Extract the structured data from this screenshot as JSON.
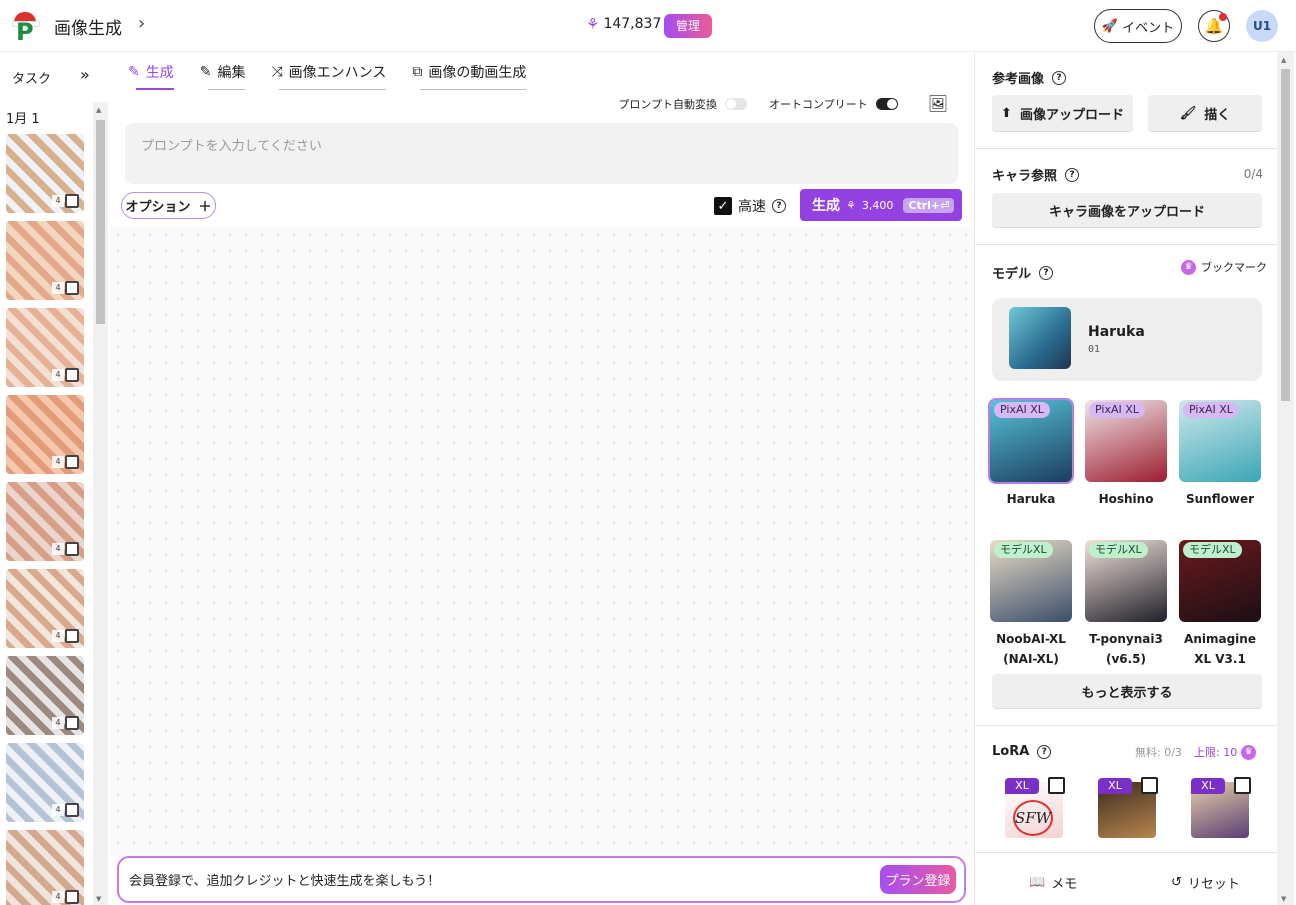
{
  "header": {
    "app_title": "画像生成",
    "credits": "147,837",
    "admin_badge": "管理",
    "event_label": "イベント",
    "avatar_initials": "U1"
  },
  "left": {
    "task_label": "タスク",
    "date_label": "1月 1",
    "thumb_count": "4",
    "thumbs": [
      {
        "c1": "#d9b08c",
        "c2": "#eef2f7"
      },
      {
        "c1": "#e3a88a",
        "c2": "#f3d6c0"
      },
      {
        "c1": "#e8b195",
        "c2": "#f2e0d4"
      },
      {
        "c1": "#e39c79",
        "c2": "#f5c8ae"
      },
      {
        "c1": "#d99e87",
        "c2": "#ead6cc"
      },
      {
        "c1": "#d9a88d",
        "c2": "#f1e6dc"
      },
      {
        "c1": "#9c8a82",
        "c2": "#e9e4e4"
      },
      {
        "c1": "#b6c3d5",
        "c2": "#eef1f6"
      },
      {
        "c1": "#d5a98e",
        "c2": "#efe5de"
      }
    ]
  },
  "tabs": [
    {
      "label": "生成",
      "icon": "✎"
    },
    {
      "label": "編集",
      "icon": "✎"
    },
    {
      "label": "画像エンハンス",
      "icon": "⤨"
    },
    {
      "label": "画像の動画生成",
      "icon": "⧉"
    }
  ],
  "toggles": {
    "auto_convert": "プロンプト自動変換",
    "autocomplete": "オートコンプリート"
  },
  "prompt": {
    "placeholder": "プロンプトを入力してください",
    "value": ""
  },
  "controls": {
    "options_label": "オプション",
    "fast_label": "高速",
    "generate_label": "生成",
    "generate_cost": "3,400",
    "shortcut": "Ctrl+⏎"
  },
  "promo": {
    "text": "会員登録で、追加クレジットと快速生成を楽しもう！",
    "button": "プラン登録"
  },
  "right": {
    "ref_title": "参考画像",
    "upload_btn": "画像アップロード",
    "draw_btn": "描く",
    "char_title": "キャラ参照",
    "char_count": "0/4",
    "char_upload_btn": "キャラ画像をアップロード",
    "model_title": "モデル",
    "bookmark_label": "ブックマーク",
    "selected_model": {
      "name": "Haruka",
      "version": "01"
    },
    "models": [
      {
        "tag": "PixAI XL",
        "name": "Haruka",
        "c1": "#57c3d9",
        "c2": "#1b3c5e"
      },
      {
        "tag": "PixAI XL",
        "name": "Hoshino",
        "c1": "#f0e6ea",
        "c2": "#9c1d2f"
      },
      {
        "tag": "PixAI XL",
        "name": "Sunflower",
        "c1": "#cfe8ec",
        "c2": "#3aa6b5"
      },
      {
        "tag": "モデルXL",
        "name": "NoobAI-XL (NAI-XL)",
        "c1": "#e9ddc4",
        "c2": "#3b4d6b"
      },
      {
        "tag": "モデルXL",
        "name": "T-ponynai3 (v6.5)",
        "c1": "#f3e2dc",
        "c2": "#1f1f28"
      },
      {
        "tag": "モデルXL",
        "name": "Animagine XL V3.1",
        "c1": "#6b1a1e",
        "c2": "#1b0f14"
      }
    ],
    "more_btn": "もっと表示する",
    "lora_title": "LoRA",
    "lora_free": "無料: 0/3",
    "lora_max": "上限: 10",
    "lora_tag": "XL",
    "lora_items": [
      {
        "c1": "#ffffff",
        "c2": "#f2d2d2",
        "text": "SFW"
      },
      {
        "c1": "#3b2b1e",
        "c2": "#b9864e",
        "text": ""
      },
      {
        "c1": "#e8cfa9",
        "c2": "#5a3f74",
        "text": ""
      }
    ],
    "memo_btn": "メモ",
    "reset_btn": "リセット"
  }
}
